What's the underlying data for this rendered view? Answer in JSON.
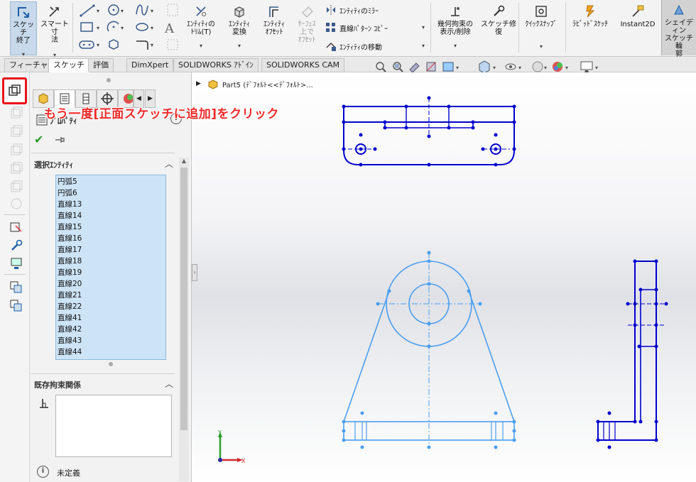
{
  "ribbon": {
    "exit_sketch": [
      "スケッチ",
      "終了"
    ],
    "smart_dim": [
      "スマート寸",
      "法"
    ],
    "trim": [
      "ｴﾝﾃｨﾃｨの",
      "ﾄﾘﾑ(T)"
    ],
    "convert": [
      "ｴﾝﾃｨﾃｨ",
      "変換"
    ],
    "offset": [
      "ｴﾝﾃｨﾃｨ",
      "ｵﾌｾｯﾄ"
    ],
    "surface_offset": [
      "ｻｰﾌｪｽ",
      "上で",
      "ｵﾌｾｯﾄ"
    ],
    "mirror": "ｴﾝﾃｨﾃｨのﾐﾗｰ",
    "linear_pattern": "直線ﾊﾟﾀｰﾝ ｺﾋﾟｰ",
    "move": "ｴﾝﾃｨﾃｨの移動",
    "relations": [
      "幾何拘束の",
      "表示/削除"
    ],
    "repair": [
      "スケッチ修",
      "復"
    ],
    "quick_snaps": "ｸｲｯｸｽﾅｯﾌﾟ",
    "rapid_sketch": "ﾗﾋﾟｯﾄﾞｽｹｯﾁ",
    "instant2d": "Instant2D",
    "shaded": [
      "シェイディン",
      "スケッチ輪",
      "郭"
    ]
  },
  "tabs": [
    "フィーチャー",
    "スケッチ",
    "評価",
    "DimXpert",
    "SOLIDWORKS ｱﾄﾞｲﾝ",
    "SOLIDWORKS CAM"
  ],
  "active_tab": "スケッチ",
  "property_manager": {
    "title": "ﾌﾟﾛﾊﾟﾃｨ",
    "help": "?",
    "selected_group": "選択ｴﾝﾃｨﾃｨ",
    "selected_items": [
      "円弧5",
      "円弧6",
      "直線13",
      "直線14",
      "直線15",
      "直線16",
      "直線17",
      "直線18",
      "直線19",
      "直線20",
      "直線21",
      "直線22",
      "直線41",
      "直線42",
      "直線43",
      "直線44"
    ],
    "relations_group": "既存拘束関係",
    "status": "未定義"
  },
  "tree": {
    "part": "Part5 (ﾃﾞﾌｫﾙﾄ<<ﾃﾞﾌｫﾙﾄ>..."
  },
  "callout": "もう一度[正面スケッチに追加]をクリック",
  "triad": {
    "x": "X",
    "y": "Y"
  },
  "colors": {
    "sketch_blue": "#0000cc",
    "light_blue": "#4a9ef0",
    "callout_red": "#f02a2a",
    "highlight_red": "#e8141a"
  }
}
